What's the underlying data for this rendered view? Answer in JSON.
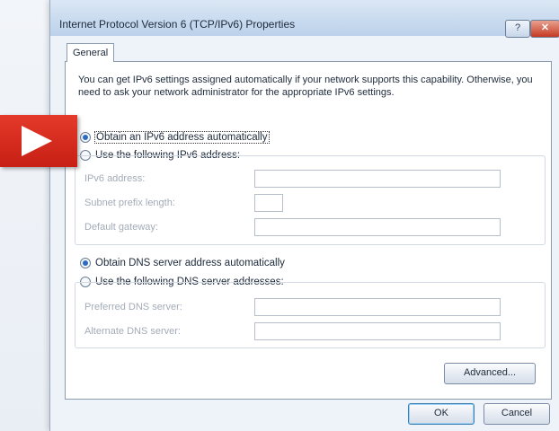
{
  "window": {
    "title": "Internet Protocol Version 6 (TCP/IPv6) Properties",
    "help_label": "?",
    "close_label": "✕"
  },
  "tabs": [
    {
      "label": "General"
    }
  ],
  "intro_text": "You can get IPv6 settings assigned automatically if your network supports this capability. Otherwise, you need to ask your network administrator for the appropriate IPv6 settings.",
  "ip_options": {
    "auto_label": "Obtain an IPv6 address automatically",
    "manual_label": "Use the following IPv6 address:",
    "selected": "auto"
  },
  "ip_fields": [
    {
      "label": "IPv6 address:",
      "value": ""
    },
    {
      "label": "Subnet prefix length:",
      "value": ""
    },
    {
      "label": "Default gateway:",
      "value": ""
    }
  ],
  "dns_options": {
    "auto_label": "Obtain DNS server address automatically",
    "manual_label": "Use the following DNS server addresses:",
    "selected": "auto"
  },
  "dns_fields": [
    {
      "label": "Preferred DNS server:",
      "value": ""
    },
    {
      "label": "Alternate DNS server:",
      "value": ""
    }
  ],
  "buttons": {
    "advanced": "Advanced...",
    "ok": "OK",
    "cancel": "Cancel"
  },
  "overlay": {
    "icon": "play-icon",
    "color": "#d42a1e"
  }
}
